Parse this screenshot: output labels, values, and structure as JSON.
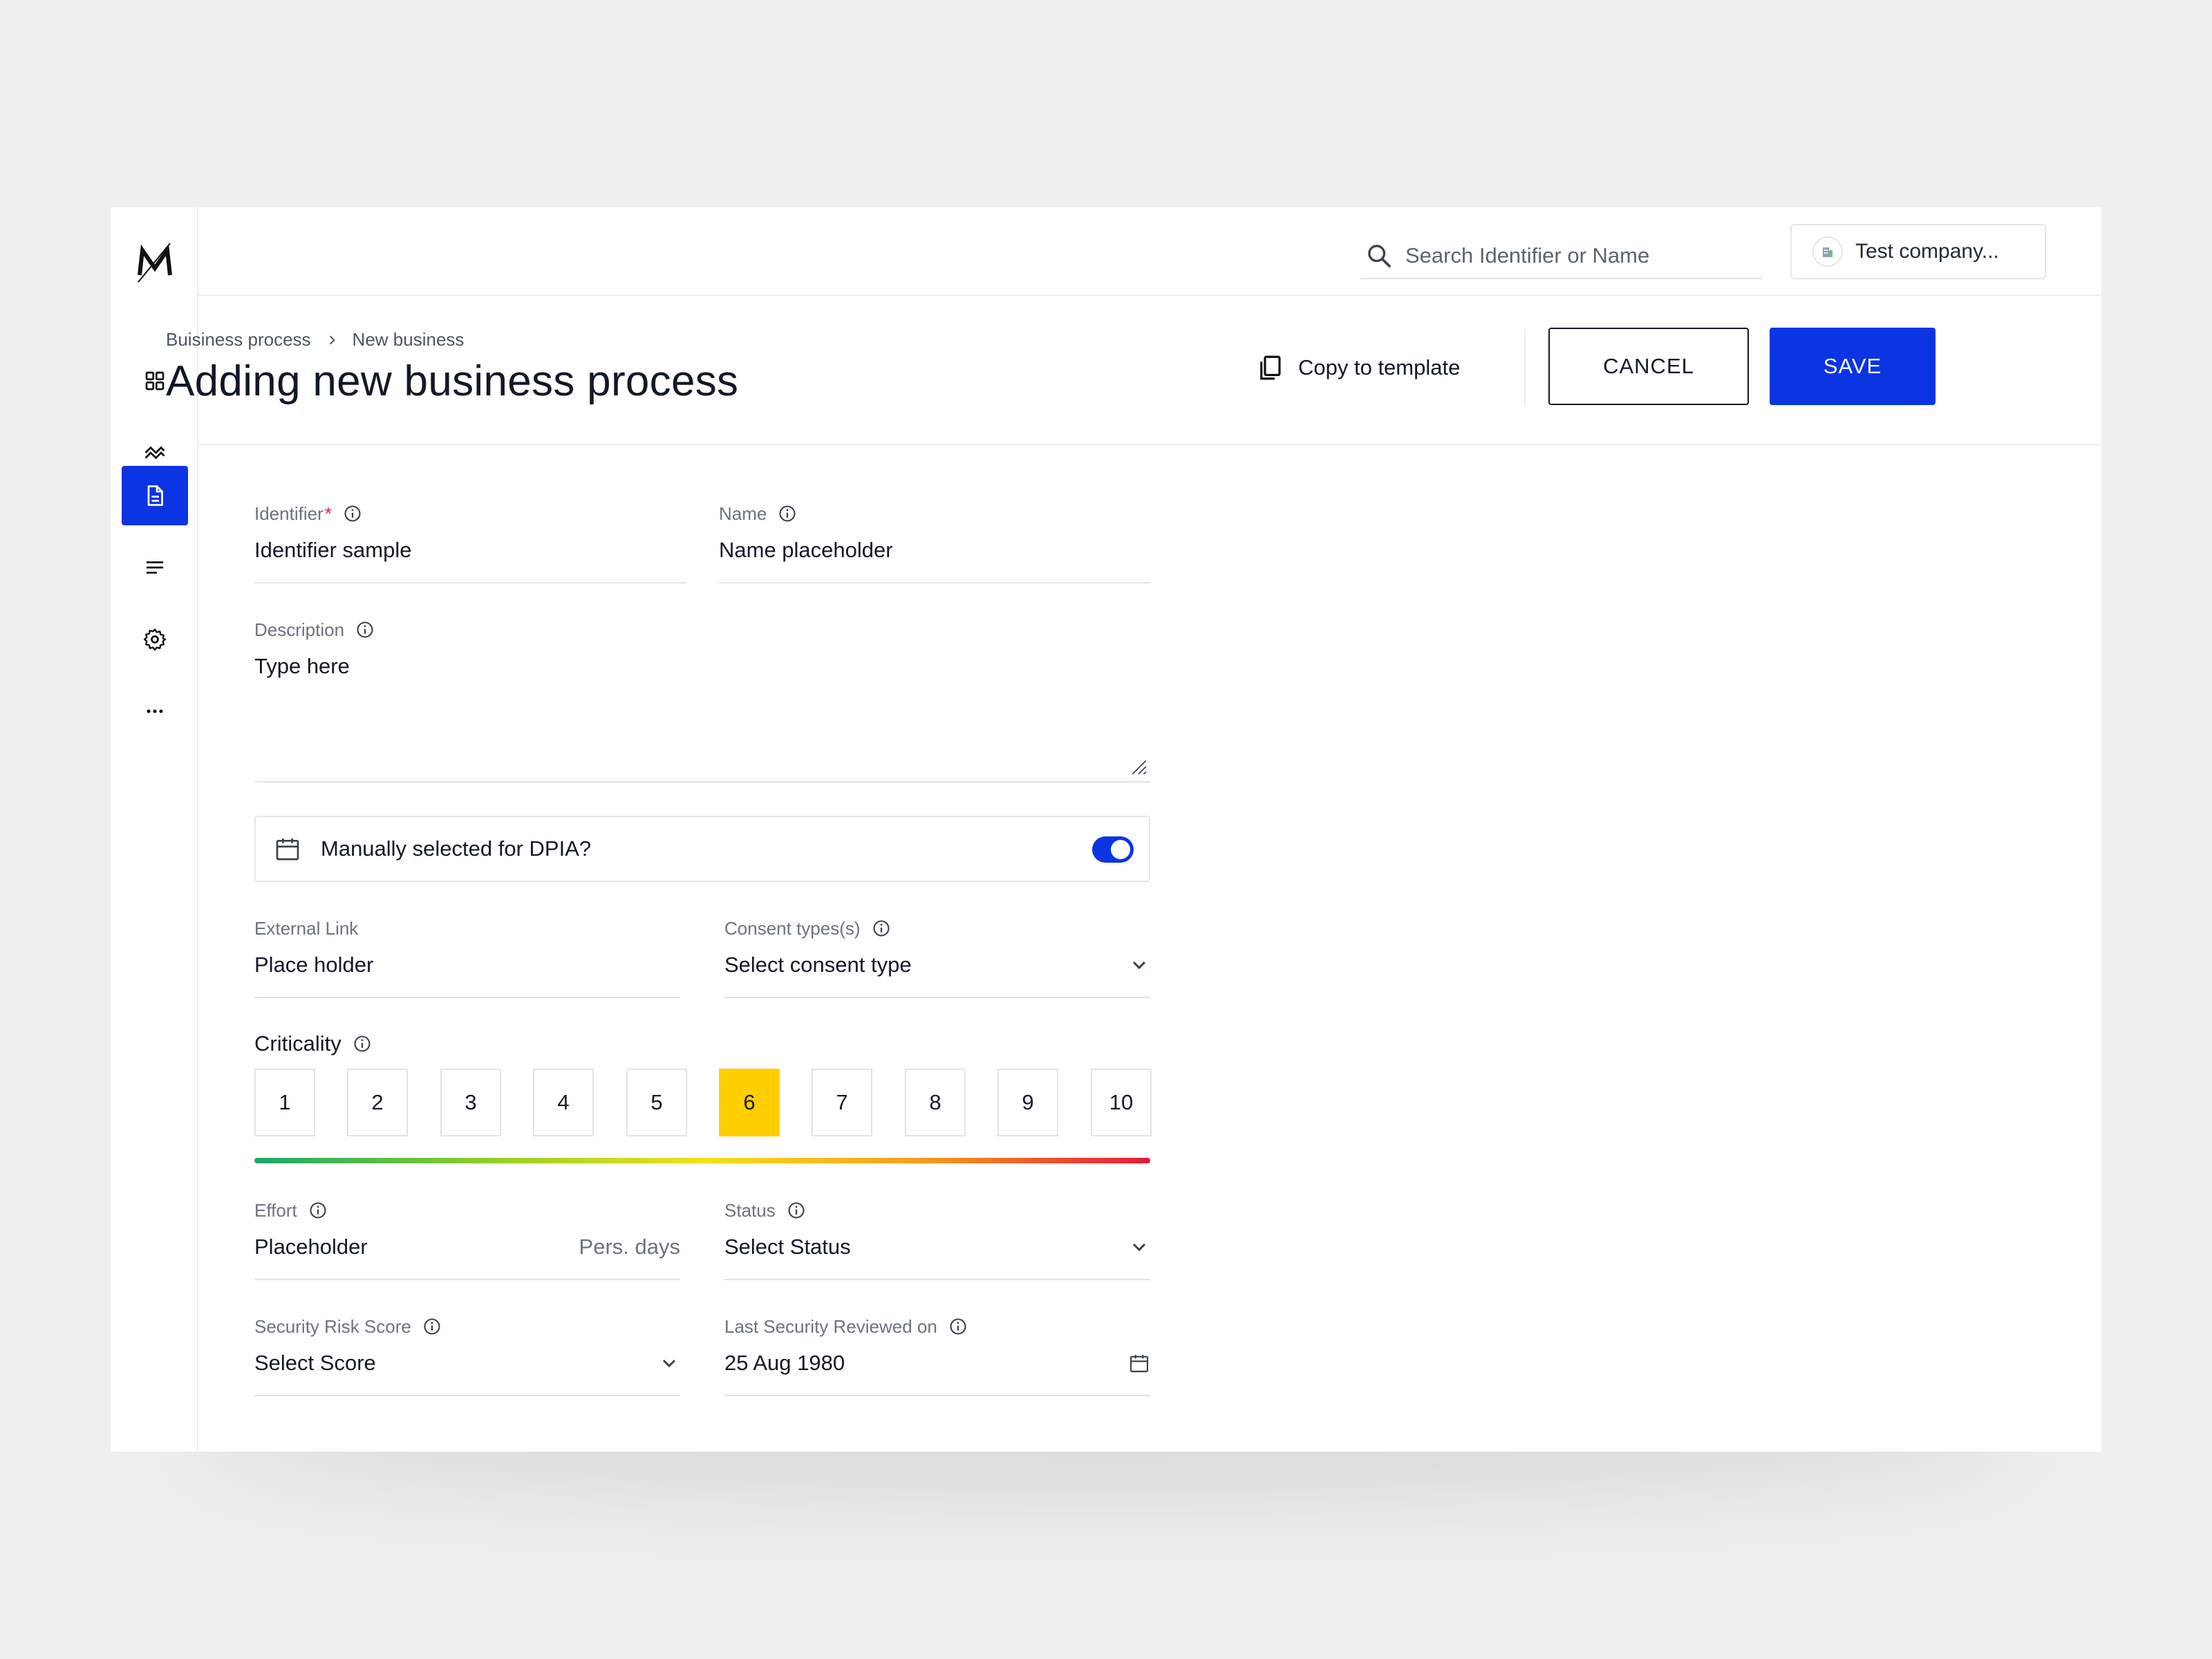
{
  "sidebar": {
    "logo": "M",
    "items": [
      {
        "icon": "grid-icon",
        "active": false
      },
      {
        "icon": "trend-icon",
        "active": false
      },
      {
        "icon": "document-icon",
        "active": true
      },
      {
        "icon": "list-icon",
        "active": false
      },
      {
        "icon": "gear-icon",
        "active": false
      },
      {
        "icon": "more-icon",
        "active": false
      }
    ]
  },
  "topbar": {
    "search_placeholder": "Search Identifier or Name",
    "company": "Test company..."
  },
  "header": {
    "breadcrumb": [
      "Buisiness process",
      "New business"
    ],
    "title": "Adding new business process",
    "copy_label": "Copy to template",
    "cancel_label": "CANCEL",
    "save_label": "SAVE"
  },
  "form": {
    "identifier": {
      "label": "Identifier",
      "required_mark": "*",
      "value": "Identifier sample"
    },
    "name": {
      "label": "Name",
      "value": "Name placeholder"
    },
    "description": {
      "label": "Description",
      "value": "Type here"
    },
    "dpia": {
      "label": "Manually selected for DPIA?",
      "enabled": true
    },
    "external_link": {
      "label": "External Link",
      "value": "Place holder"
    },
    "consent": {
      "label": "Consent types(s)",
      "value": "Select consent type"
    },
    "criticality": {
      "label": "Criticality",
      "options": [
        "1",
        "2",
        "3",
        "4",
        "5",
        "6",
        "7",
        "8",
        "9",
        "10"
      ],
      "selected": "6"
    },
    "effort": {
      "label": "Effort",
      "value": "Placeholder",
      "unit": "Pers. days"
    },
    "status": {
      "label": "Status",
      "value": "Select Status"
    },
    "security_risk": {
      "label": "Security Risk Score",
      "value": "Select Score"
    },
    "last_reviewed": {
      "label": "Last Security Reviewed on",
      "value": "25 Aug 1980"
    }
  },
  "colors": {
    "accent": "#0b35e3",
    "selected": "#ffce00",
    "required": "#e11d48"
  }
}
